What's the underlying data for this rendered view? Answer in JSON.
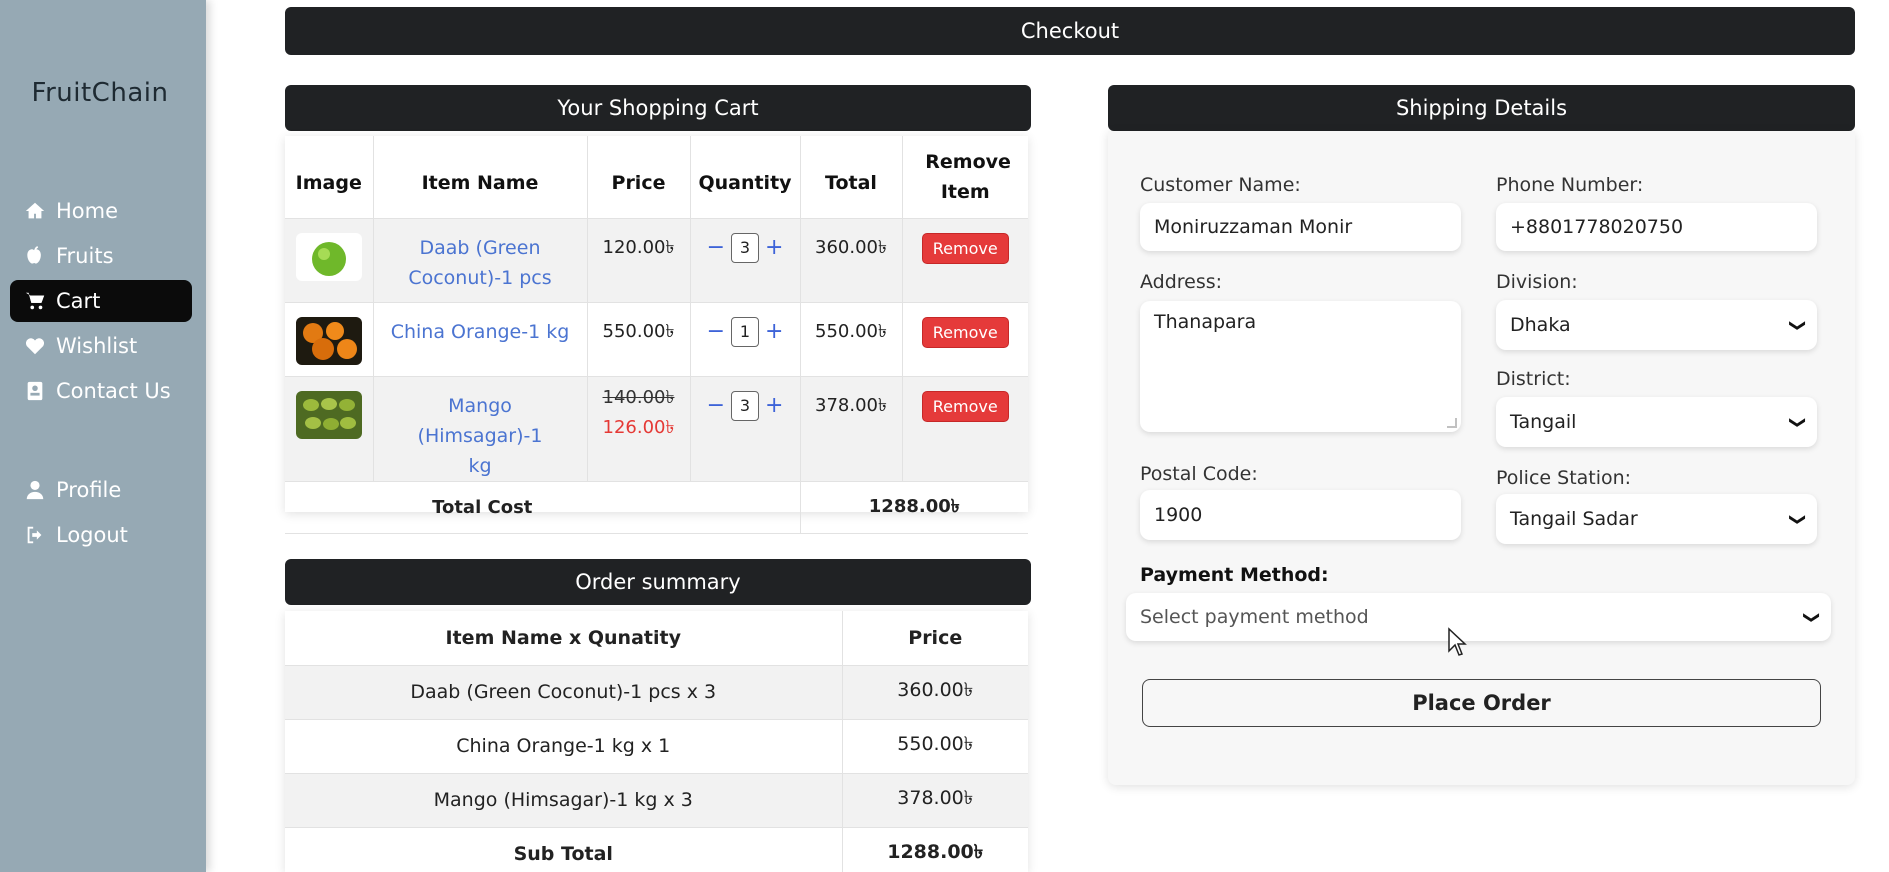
{
  "sidebar": {
    "brand": "FruitChain",
    "items": [
      {
        "label": "Home",
        "icon": "home-icon"
      },
      {
        "label": "Fruits",
        "icon": "apple-icon"
      },
      {
        "label": "Cart",
        "icon": "cart-icon"
      },
      {
        "label": "Wishlist",
        "icon": "heart-icon"
      },
      {
        "label": "Contact Us",
        "icon": "contact-icon"
      },
      {
        "label": "Profile",
        "icon": "user-icon"
      },
      {
        "label": "Logout",
        "icon": "logout-icon"
      }
    ],
    "active": "Cart"
  },
  "checkout": {
    "title": "Checkout"
  },
  "cart": {
    "title": "Your Shopping Cart",
    "columns": [
      "Image",
      "Item Name",
      "Price",
      "Quantity",
      "Total",
      "Remove Item"
    ],
    "rows": [
      {
        "name": "Daab (Green Coconut)-1 pcs",
        "price": "120.00৳",
        "qty": "3",
        "total": "360.00৳",
        "remove": "Remove"
      },
      {
        "name": "China Orange-1 kg",
        "price": "550.00৳",
        "qty": "1",
        "total": "550.00৳",
        "remove": "Remove"
      },
      {
        "name": "Mango (Himsagar)-1 kg",
        "price": "140.00৳",
        "discount_price": "126.00৳",
        "qty": "3",
        "total": "378.00৳",
        "remove": "Remove"
      }
    ],
    "total_label": "Total Cost",
    "total_value": "1288.00৳",
    "qty_minus": "−",
    "qty_plus": "+"
  },
  "summary": {
    "title": "Order summary",
    "columns": [
      "Item Name x Qunatity",
      "Price"
    ],
    "rows": [
      {
        "item": "Daab (Green Coconut)-1 pcs x 3",
        "price": "360.00৳"
      },
      {
        "item": "China Orange-1 kg x 1",
        "price": "550.00৳"
      },
      {
        "item": "Mango (Himsagar)-1 kg x 3",
        "price": "378.00৳"
      }
    ],
    "subtotal_label": "Sub Total",
    "subtotal_value": "1288.00৳"
  },
  "shipping": {
    "title": "Shipping Details",
    "customer_name_label": "Customer Name:",
    "customer_name": "Moniruzzaman Monir",
    "phone_label": "Phone Number:",
    "phone": "+8801778020750",
    "address_label": "Address:",
    "address": "Thanapara",
    "division_label": "Division:",
    "division": "Dhaka",
    "district_label": "District:",
    "district": "Tangail",
    "postal_label": "Postal Code:",
    "postal": "1900",
    "police_label": "Police Station:",
    "police": "Tangail Sadar",
    "payment_label": "Payment Method:",
    "payment_placeholder": "Select payment method",
    "place_order": "Place Order"
  },
  "colors": {
    "sidebar_bg": "#96a9b4",
    "header_bar": "#202224",
    "link": "#4b74d1",
    "remove": "#e53a3a"
  }
}
